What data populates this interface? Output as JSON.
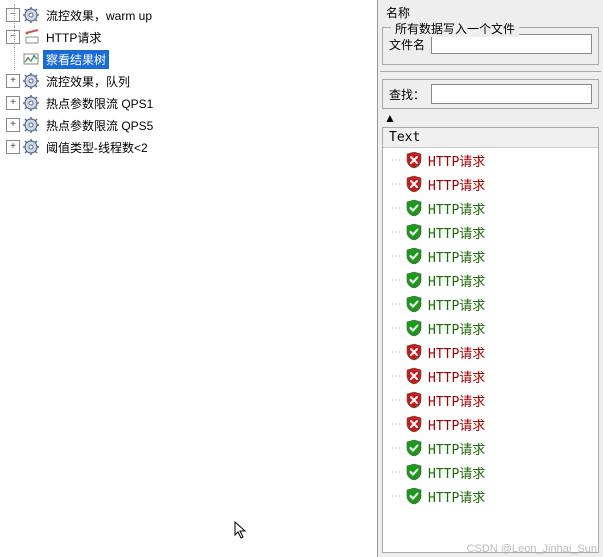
{
  "tree": {
    "items": [
      {
        "label": "流控效果，warm up",
        "toggle": "−",
        "icon": "gear",
        "children": [
          {
            "label": "HTTP请求",
            "toggle": "−",
            "icon": "http",
            "children": [
              {
                "label": "察看结果树",
                "icon": "results",
                "selected": true
              }
            ]
          }
        ]
      },
      {
        "label": "流控效果，队列",
        "toggle": "+",
        "icon": "gear"
      },
      {
        "label": "热点参数限流 QPS1",
        "toggle": "+",
        "icon": "gear"
      },
      {
        "label": "热点参数限流 QPS5",
        "toggle": "+",
        "icon": "gear"
      },
      {
        "label": "阈值类型-线程数<2",
        "toggle": "+",
        "icon": "gear"
      }
    ]
  },
  "rightPane": {
    "topLabel": "名称",
    "fieldset": {
      "legend": "所有数据写入一个文件",
      "filenameLabel": "文件名"
    },
    "searchLabel": "查找：",
    "upArrow": "▲",
    "resultsHeader": "Text",
    "results": [
      {
        "label": "HTTP请求",
        "status": "err"
      },
      {
        "label": "HTTP请求",
        "status": "err"
      },
      {
        "label": "HTTP请求",
        "status": "ok"
      },
      {
        "label": "HTTP请求",
        "status": "ok"
      },
      {
        "label": "HTTP请求",
        "status": "ok"
      },
      {
        "label": "HTTP请求",
        "status": "ok"
      },
      {
        "label": "HTTP请求",
        "status": "ok"
      },
      {
        "label": "HTTP请求",
        "status": "ok"
      },
      {
        "label": "HTTP请求",
        "status": "err"
      },
      {
        "label": "HTTP请求",
        "status": "err"
      },
      {
        "label": "HTTP请求",
        "status": "err"
      },
      {
        "label": "HTTP请求",
        "status": "err"
      },
      {
        "label": "HTTP请求",
        "status": "ok"
      },
      {
        "label": "HTTP请求",
        "status": "ok"
      },
      {
        "label": "HTTP请求",
        "status": "ok"
      }
    ]
  },
  "watermark": "CSDN @Leon_Jinhai_Sun"
}
